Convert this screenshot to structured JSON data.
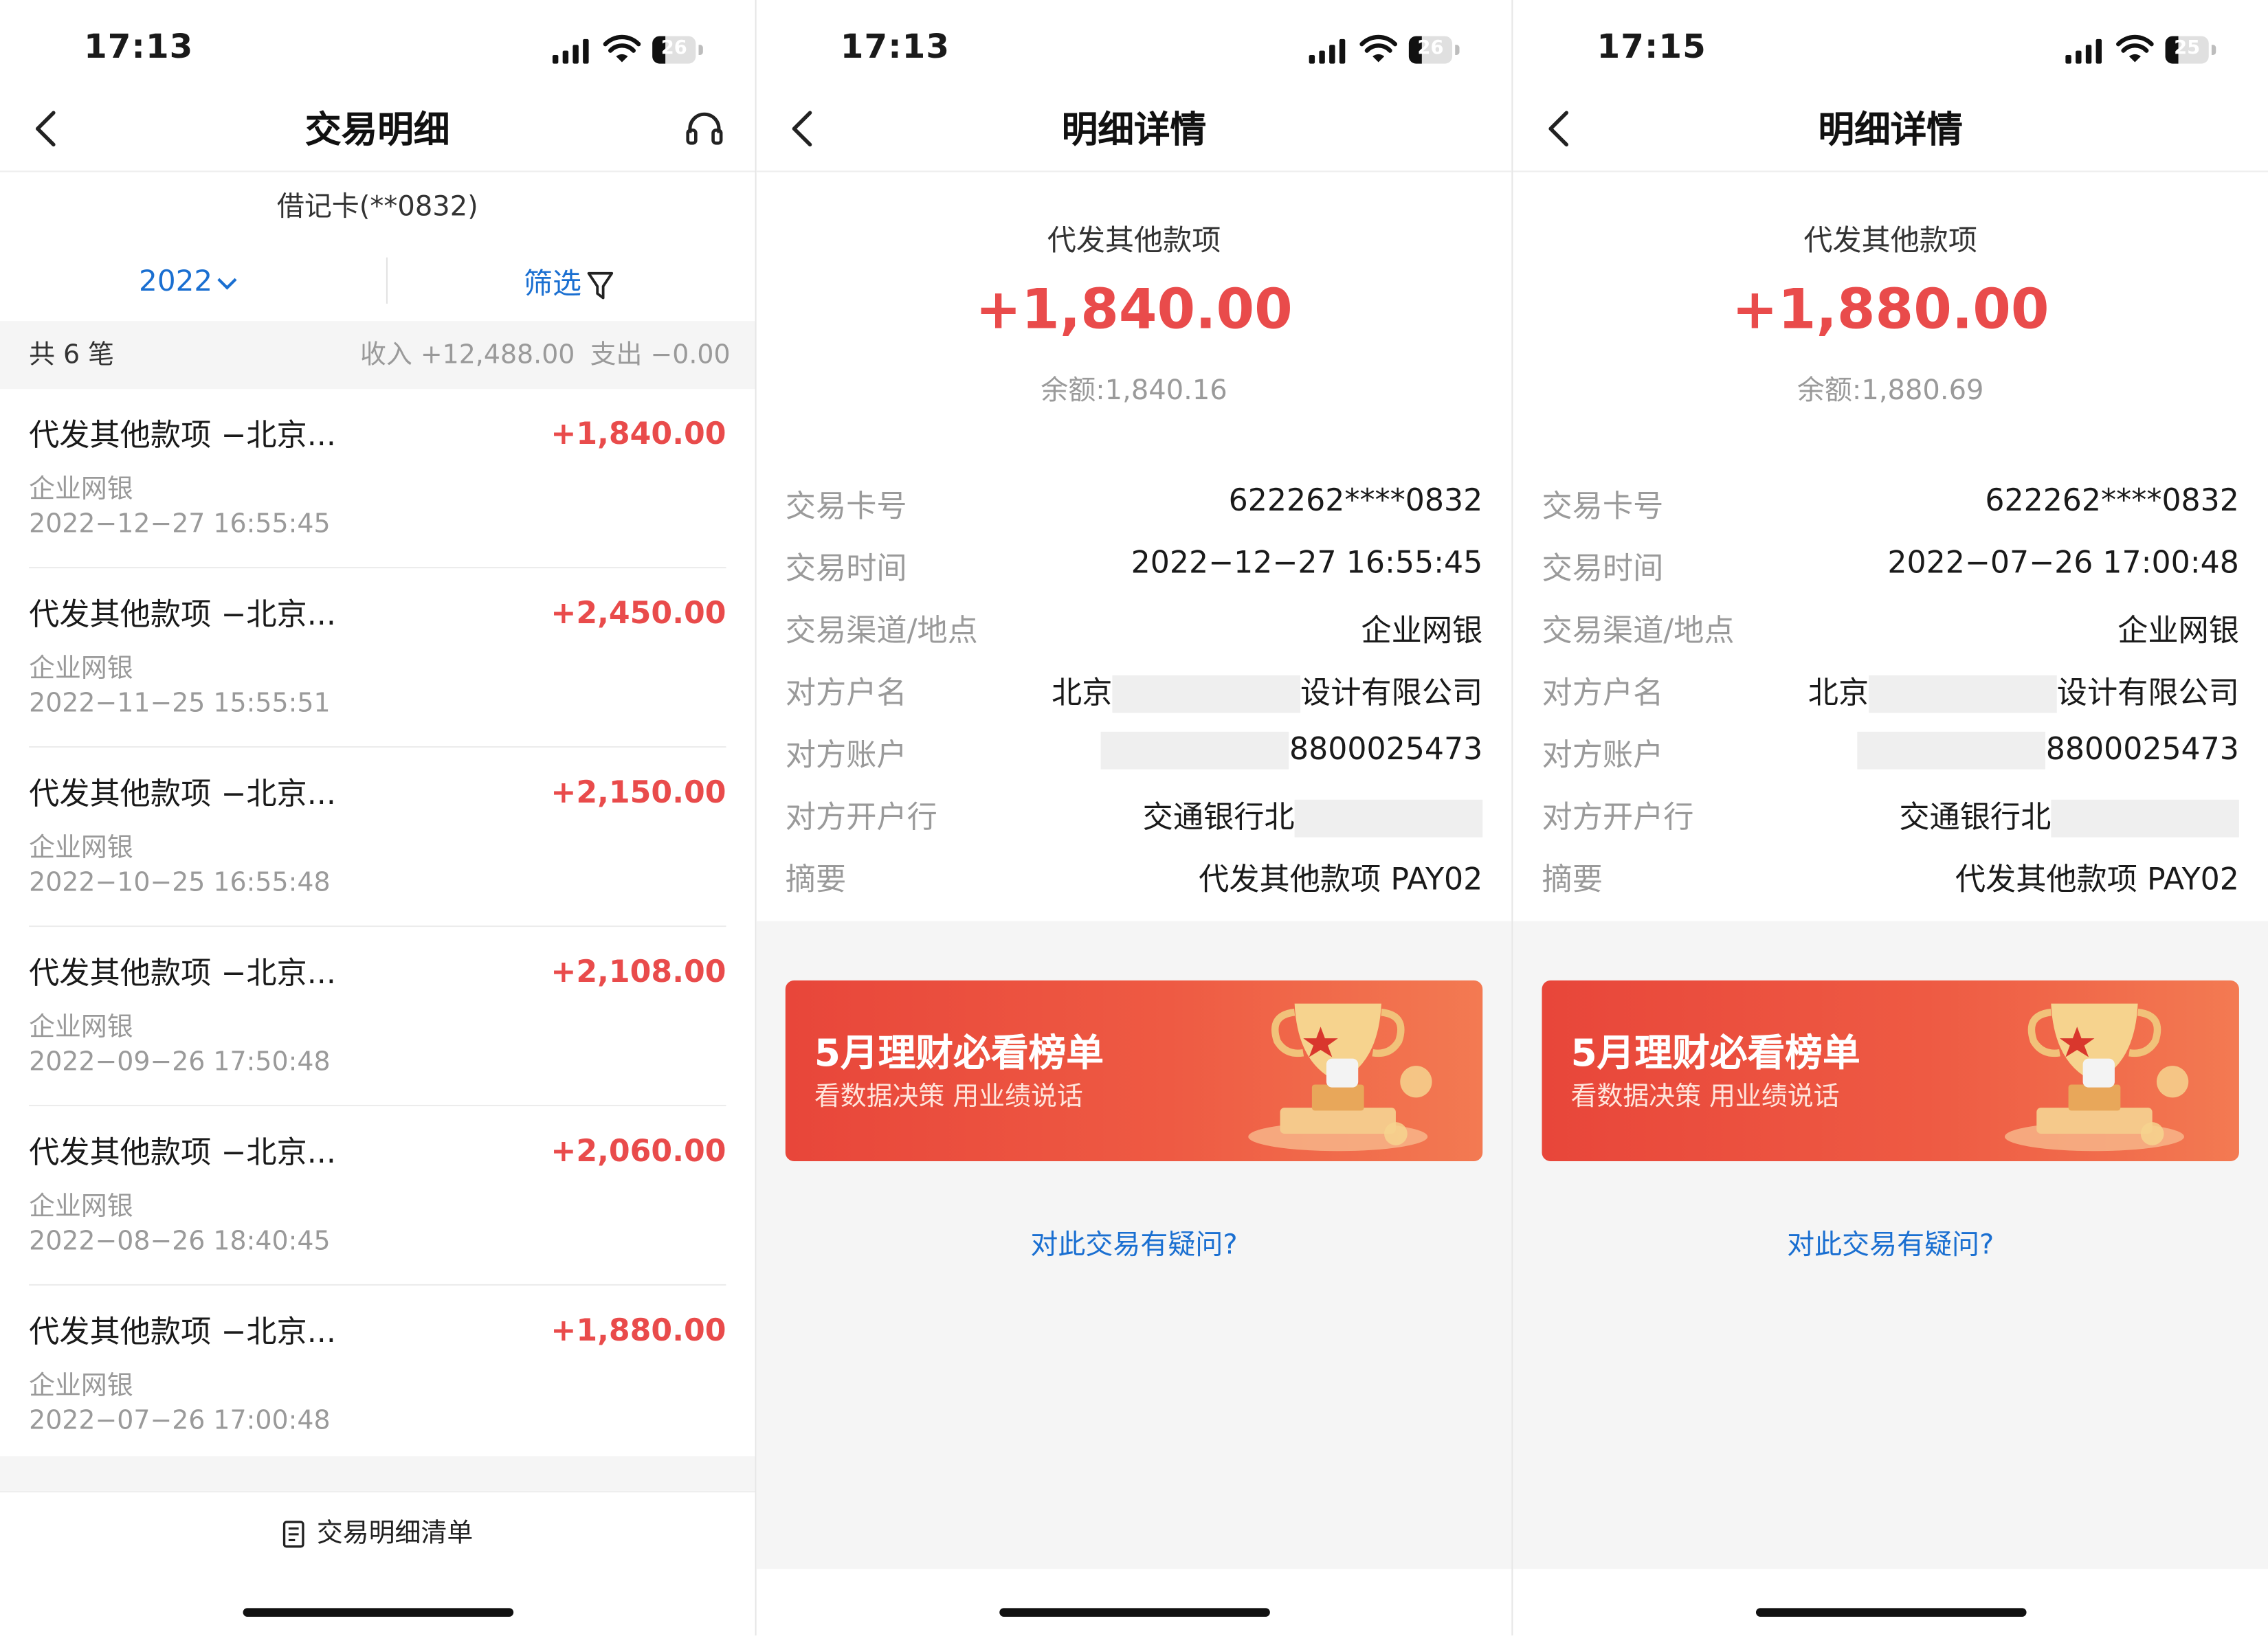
{
  "status_bars": [
    {
      "time": "17:13",
      "battery": "26"
    },
    {
      "time": "17:13",
      "battery": "26"
    },
    {
      "time": "17:15",
      "battery": "25"
    }
  ],
  "list_screen": {
    "title": "交易明细",
    "card_label": "借记卡(**0832)",
    "year_selector": "2022",
    "filter_label": "筛选",
    "summary": {
      "count_label": "共 6 笔",
      "income_label": "收入 +12,488.00",
      "expense_label": "支出 −0.00"
    },
    "transactions": [
      {
        "title": "代发其他款项 −北京...",
        "amount": "+1,840.00",
        "channel": "企业网银",
        "time": "2022−12−27 16:55:45"
      },
      {
        "title": "代发其他款项 −北京...",
        "amount": "+2,450.00",
        "channel": "企业网银",
        "time": "2022−11−25 15:55:51"
      },
      {
        "title": "代发其他款项 −北京...",
        "amount": "+2,150.00",
        "channel": "企业网银",
        "time": "2022−10−25 16:55:48"
      },
      {
        "title": "代发其他款项 −北京...",
        "amount": "+2,108.00",
        "channel": "企业网银",
        "time": "2022−09−26 17:50:48"
      },
      {
        "title": "代发其他款项 −北京...",
        "amount": "+2,060.00",
        "channel": "企业网银",
        "time": "2022−08−26 18:40:45"
      },
      {
        "title": "代发其他款项 −北京...",
        "amount": "+1,880.00",
        "channel": "企业网银",
        "time": "2022−07−26 17:00:48"
      }
    ],
    "footer_label": "交易明细清单"
  },
  "detail_screens": [
    {
      "title": "明细详情",
      "type": "代发其他款项",
      "amount": "+1,840.00",
      "balance": "余额:1,840.16",
      "fields": {
        "card_label": "交易卡号",
        "card_value": "622262****0832",
        "time_label": "交易时间",
        "time_value": "2022−12−27 16:55:45",
        "channel_label": "交易渠道/地点",
        "channel_value": "企业网银",
        "payer_label": "对方户名",
        "payer_prefix": "北京",
        "payer_suffix": "设计有限公司",
        "account_label": "对方账户",
        "account_value": "8800025473",
        "bank_label": "对方开户行",
        "bank_value": "交通银行北",
        "memo_label": "摘要",
        "memo_value": "代发其他款项 PAY02"
      },
      "banner": {
        "title": "5月理财必看榜单",
        "subtitle": "看数据决策 用业绩说话"
      },
      "question_link": "对此交易有疑问?"
    },
    {
      "title": "明细详情",
      "type": "代发其他款项",
      "amount": "+1,880.00",
      "balance": "余额:1,880.69",
      "fields": {
        "card_label": "交易卡号",
        "card_value": "622262****0832",
        "time_label": "交易时间",
        "time_value": "2022−07−26 17:00:48",
        "channel_label": "交易渠道/地点",
        "channel_value": "企业网银",
        "payer_label": "对方户名",
        "payer_prefix": "北京",
        "payer_suffix": "设计有限公司",
        "account_label": "对方账户",
        "account_value": "8800025473",
        "bank_label": "对方开户行",
        "bank_value": "交通银行北",
        "memo_label": "摘要",
        "memo_value": "代发其他款项 PAY02"
      },
      "banner": {
        "title": "5月理财必看榜单",
        "subtitle": "看数据决策 用业绩说话"
      },
      "question_link": "对此交易有疑问?"
    }
  ],
  "colors": {
    "accent_blue": "#1a6fd1",
    "amount_red": "#e94b4b",
    "banner_red": "#e8463a"
  },
  "icons": [
    "signal-icon",
    "wifi-icon",
    "battery-icon",
    "back-arrow-icon",
    "headset-icon",
    "chevron-down-icon",
    "filter-funnel-icon",
    "document-list-icon",
    "trophy-icon"
  ]
}
